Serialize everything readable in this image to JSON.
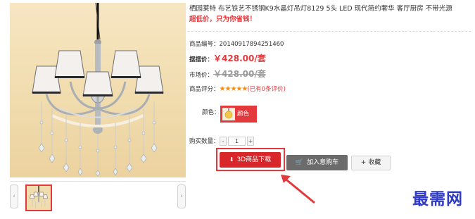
{
  "product": {
    "title": "栖园莱特 布艺铁艺不锈钢K9水晶灯吊灯8129 5头 LED 现代简约奢华 客厅厨房 不带光源",
    "promo": "超低价，只为你省钱！",
    "code_label": "商品编号：",
    "code_value": "20140917894251460",
    "price_label": "摆摆价：",
    "price_value": "￥428.00/套",
    "market_label": "市场价：",
    "market_value": "￥428.00/套",
    "rating_label": "商品评分：",
    "rating_stars": "★★★★★",
    "rating_count": "(已有0条评价)",
    "color_label": "颜色：",
    "color_option": "颜色",
    "qty_label": "购买数量：",
    "qty_minus": "-",
    "qty_value": "1",
    "qty_plus": "+"
  },
  "actions": {
    "download_3d": "3D商品下载",
    "add_to_cart": "加入意购车",
    "favorite": "收藏"
  },
  "icons": {
    "download": "download-icon",
    "cart": "cart-icon",
    "plus": "plus-icon"
  },
  "thumbs": {
    "left_arrow": "‹",
    "right_arrow": "›"
  },
  "watermark": "最需网",
  "colors": {
    "accent_red": "#e4393c",
    "button_red": "#d8262b",
    "watermark_blue": "#2e39c8"
  }
}
